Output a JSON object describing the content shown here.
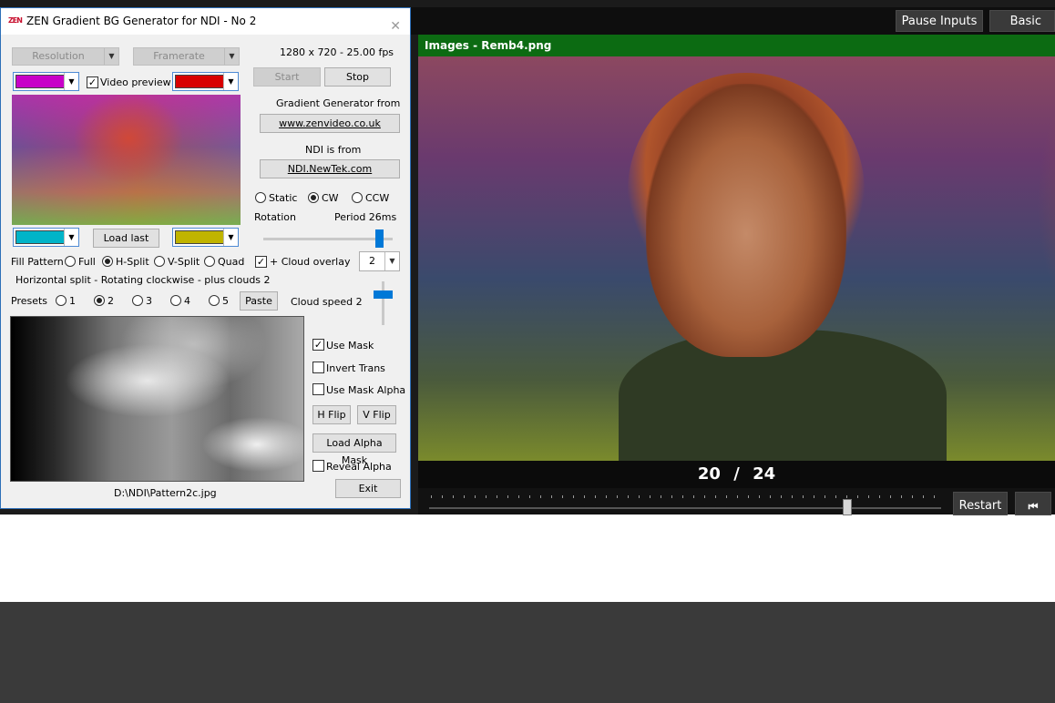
{
  "vmix": {
    "pause_inputs_label": "Pause Inputs",
    "basic_label": "Basic",
    "preview_title": "Images - Remb4.png",
    "counter_current": "20",
    "counter_sep": "/",
    "counter_total": "24",
    "restart_label": "Restart",
    "skip_back_icon": "skip-to-start-icon"
  },
  "dialog": {
    "title": "ZEN Gradient BG Generator for NDI - No 2",
    "app_icon_text": "ZEN",
    "close_icon": "close-icon",
    "resolution_label": "Resolution",
    "framerate_label": "Framerate",
    "format_text": "1280 x 720 - 25.00 fps",
    "start_label": "Start",
    "stop_label": "Stop",
    "video_preview_label": "Video preview",
    "video_preview_checked": true,
    "swatch_top_left": "#c800c8",
    "swatch_top_right": "#d80000",
    "swatch_bottom_left": "#00b4c8",
    "swatch_bottom_right": "#c0b400",
    "gradient_from_label": "Gradient Generator from",
    "zen_link": "www.zenvideo.co.uk",
    "ndi_from_label": "NDI is from",
    "ndi_link": "NDI.NewTek.com",
    "rotation_options": [
      "Static",
      "CW",
      "CCW"
    ],
    "rotation_selected": "CW",
    "rotation_label": "Rotation",
    "period_label": "Period 26ms",
    "load_last_label": "Load last",
    "fill_pattern_label": "Fill Pattern",
    "fill_options": [
      "Full",
      "H-Split",
      "V-Split",
      "Quad"
    ],
    "fill_selected": "H-Split",
    "cloud_overlay_label": "+ Cloud overlay",
    "cloud_overlay_checked": true,
    "cloud_value": "2",
    "description": "Horizontal split - Rotating clockwise - plus clouds 2",
    "presets_label": "Presets",
    "preset_options": [
      "1",
      "2",
      "3",
      "4",
      "5"
    ],
    "preset_selected": "2",
    "paste_label": "Paste",
    "cloud_speed_label": "Cloud speed 2",
    "use_mask_label": "Use Mask",
    "use_mask_checked": true,
    "invert_trans_label": "Invert Trans",
    "use_mask_alpha_label": "Use Mask Alpha",
    "hflip_label": "H Flip",
    "vflip_label": "V Flip",
    "load_alpha_mask_label": "Load Alpha Mask",
    "reveal_alpha_label": "Reveal Alpha",
    "mask_path": "D:\\NDI\\Pattern2c.jpg",
    "exit_label": "Exit"
  }
}
